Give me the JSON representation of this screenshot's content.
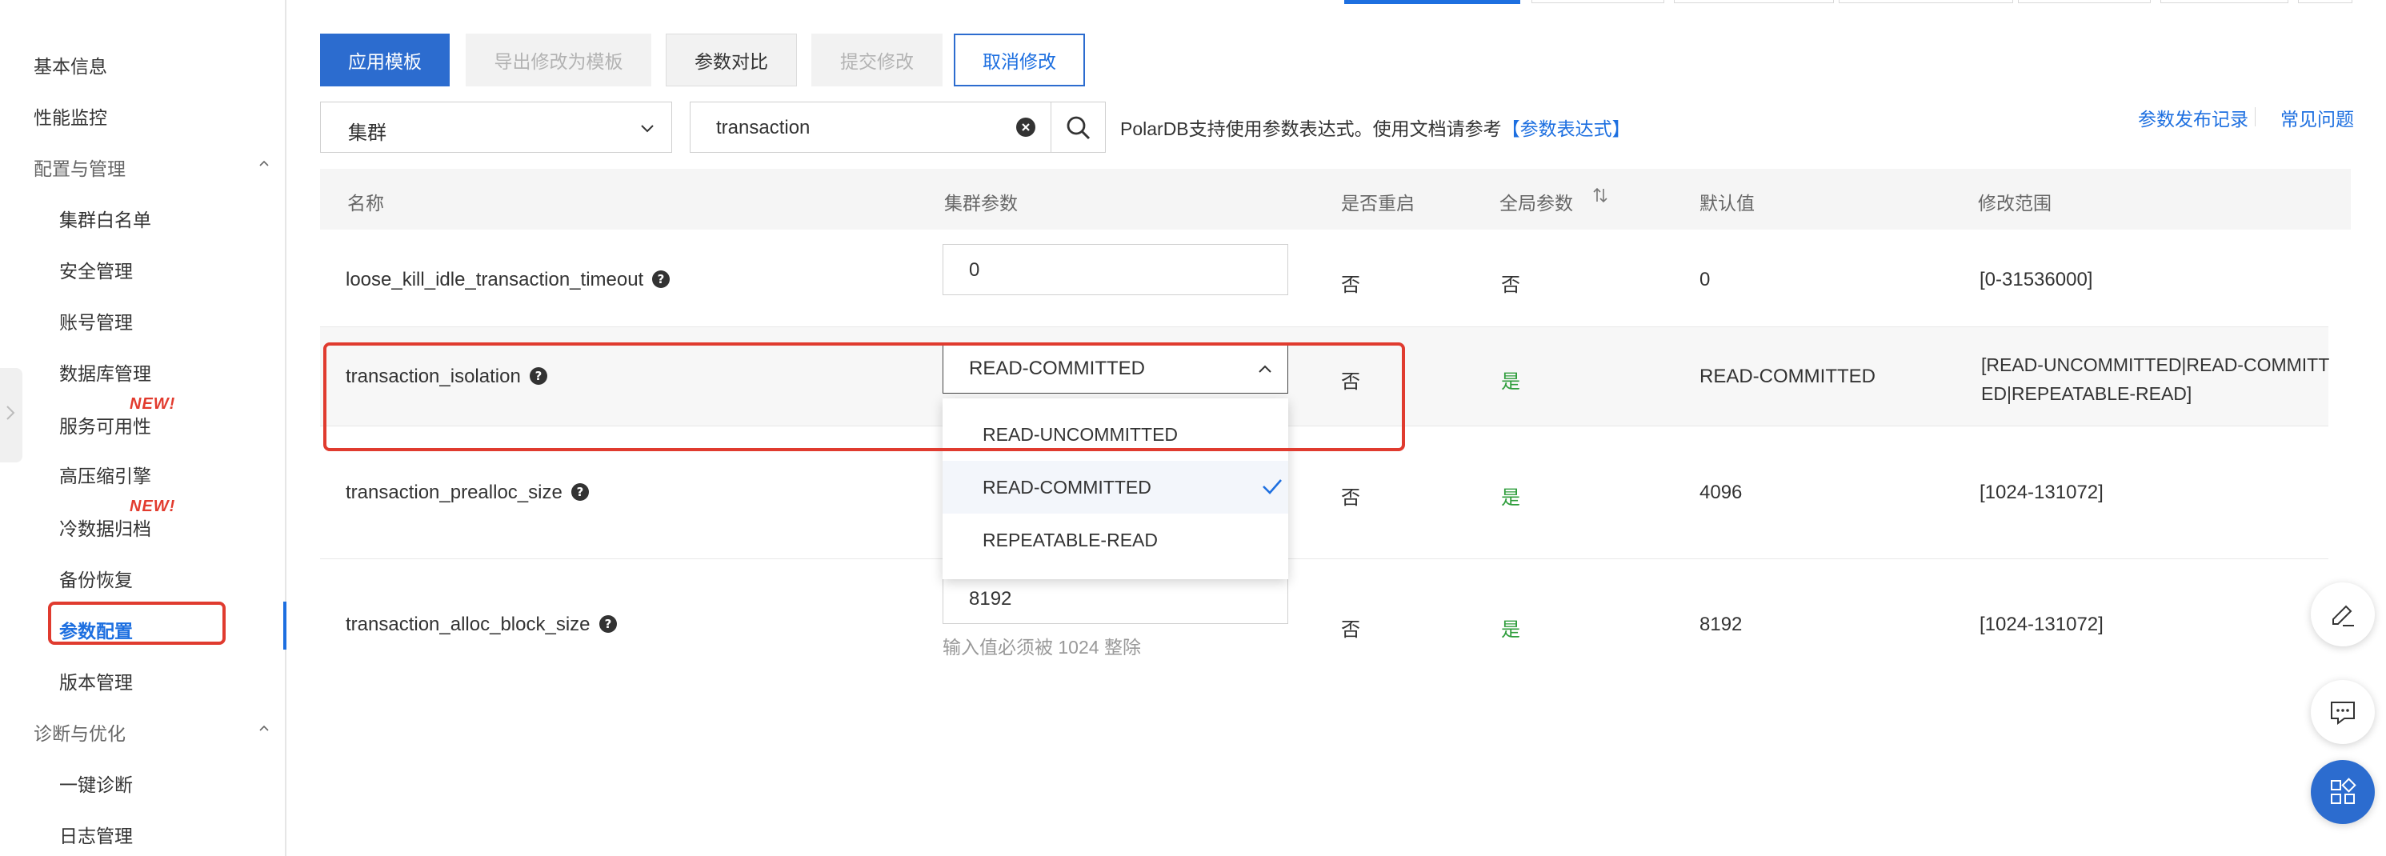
{
  "sidebar": {
    "items": [
      {
        "label": "基本信息"
      },
      {
        "label": "性能监控"
      }
    ],
    "group_config": {
      "label": "配置与管理",
      "items": [
        {
          "label": "集群白名单"
        },
        {
          "label": "安全管理"
        },
        {
          "label": "账号管理"
        },
        {
          "label": "数据库管理"
        },
        {
          "label": "服务可用性",
          "badge": "NEW!"
        },
        {
          "label": "高压缩引擎"
        },
        {
          "label": "冷数据归档",
          "badge": "NEW!"
        },
        {
          "label": "备份恢复"
        },
        {
          "label": "参数配置",
          "active": true
        },
        {
          "label": "版本管理"
        }
      ]
    },
    "group_diag": {
      "label": "诊断与优化",
      "items": [
        {
          "label": "一键诊断"
        },
        {
          "label": "日志管理"
        }
      ]
    }
  },
  "toolbar": {
    "apply_template": "应用模板",
    "export_template": "导出修改为模板",
    "compare_params": "参数对比",
    "submit": "提交修改",
    "cancel": "取消修改"
  },
  "filter": {
    "scope_value": "集群",
    "search_value": "transaction",
    "hint_text": "PolarDB支持使用参数表达式。使用文档请参考",
    "hint_link": "【参数表达式】",
    "publish_record": "参数发布记录",
    "faq": "常见问题"
  },
  "table": {
    "headers": {
      "name": "名称",
      "cluster_param": "集群参数",
      "restart": "是否重启",
      "global": "全局参数",
      "default": "默认值",
      "range": "修改范围"
    },
    "rows": [
      {
        "name": "loose_kill_idle_transaction_timeout",
        "value": "0",
        "restart": "否",
        "global": "否",
        "default": "0",
        "range": "[0-31536000]"
      },
      {
        "name": "transaction_isolation",
        "value": "READ-COMMITTED",
        "restart": "否",
        "global": "是",
        "default": "READ-COMMITTED",
        "range": "[READ-UNCOMMITTED|READ-COMMITTED|REPEATABLE-READ]"
      },
      {
        "name": "transaction_prealloc_size",
        "value": "",
        "restart": "否",
        "global": "是",
        "default": "4096",
        "range": "[1024-131072]"
      },
      {
        "name": "transaction_alloc_block_size",
        "value": "8192",
        "restart": "否",
        "global": "是",
        "default": "8192",
        "range": "[1024-131072]",
        "help": "输入值必须被 1024 整除"
      }
    ]
  },
  "dropdown": {
    "options": [
      "READ-UNCOMMITTED",
      "READ-COMMITTED",
      "REPEATABLE-READ"
    ],
    "selected": "READ-COMMITTED"
  },
  "colors": {
    "primary": "#2c6ccf",
    "link": "#1d6fe0",
    "green": "#2e9d3b",
    "badge_red": "#e23b2e",
    "highlight_red": "#e03b2f"
  },
  "icons": {
    "float_buttons": [
      "edit-icon",
      "chat-icon",
      "apps-icon"
    ]
  }
}
